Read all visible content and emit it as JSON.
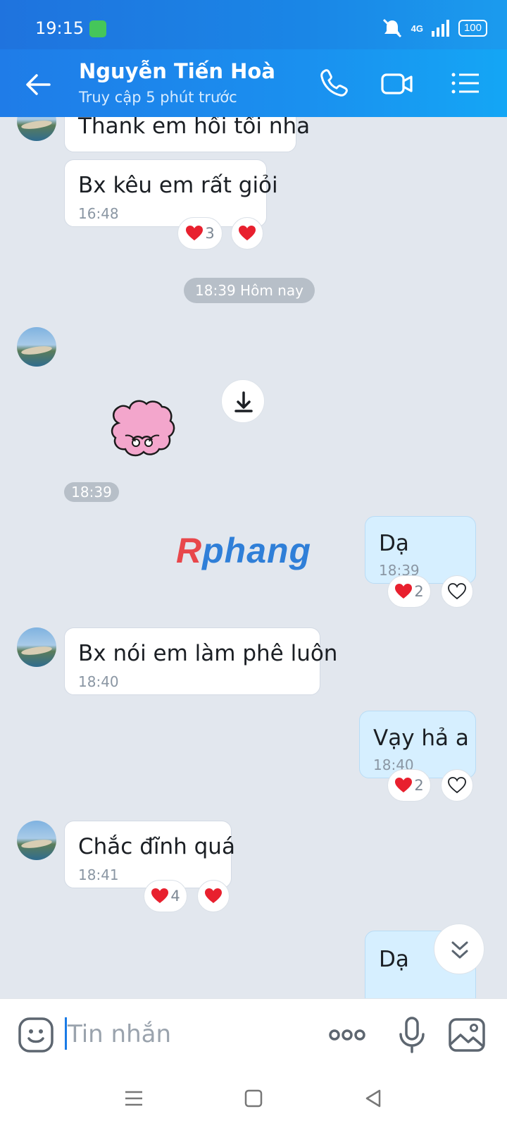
{
  "status": {
    "time": "19:15",
    "network": "4G",
    "battery": "100"
  },
  "header": {
    "title": "Nguyễn Tiến Hoà",
    "subtitle": "Truy cập 5 phút trước"
  },
  "messages": [
    {
      "text": "Thank em hồi tối nha"
    },
    {
      "text": "Bx kêu em rất giỏi",
      "time": "16:48",
      "reaction_count": "3"
    },
    {
      "divider": "18:39 Hôm nay"
    },
    {
      "sticker_time": "18:39"
    },
    {
      "text": "Dạ",
      "time": "18:39",
      "reaction_count": "2"
    },
    {
      "text": "Bx nói em làm phê luôn",
      "time": "18:40"
    },
    {
      "text": "Vạy hả a",
      "time": "18:40",
      "reaction_count": "2"
    },
    {
      "text": "Chắc đĩnh quá",
      "time": "18:41",
      "reaction_count": "4"
    },
    {
      "text": "Dạ"
    }
  ],
  "watermark": {
    "part1": "R",
    "part2": "phang"
  },
  "input": {
    "placeholder": "Tin nhắn"
  },
  "colors": {
    "accent": "#1a86e6",
    "heart": "#e8202e",
    "my_bubble": "#d6efff"
  },
  "icons": [
    "back-arrow-icon",
    "phone-icon",
    "video-call-icon",
    "menu-list-icon",
    "download-icon",
    "chevron-double-down-icon",
    "emoji-icon",
    "more-dots-icon",
    "microphone-icon",
    "image-icon"
  ]
}
